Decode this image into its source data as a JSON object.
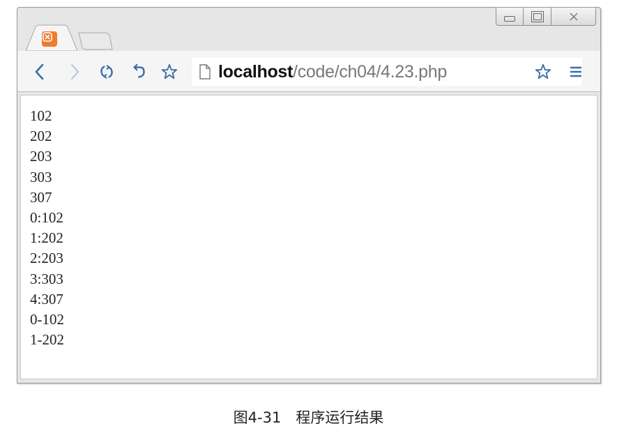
{
  "browser": {
    "address": {
      "host": "localhost",
      "path": "/code/ch04/4.23.php"
    },
    "icons": {
      "back": "back-arrow-icon",
      "forward": "forward-arrow-icon",
      "reload": "reload-icon",
      "undo": "undo-icon",
      "bookmark": "star-icon",
      "page": "page-icon",
      "menu": "menu-icon",
      "tab_favicon": "xampp-icon"
    },
    "colors": {
      "favicon": "#f07b2b",
      "toolbar_icon": "#3b6ea8"
    }
  },
  "page": {
    "lines": [
      "102",
      "202",
      "203",
      "303",
      "307",
      "0:102",
      "1:202",
      "2:203",
      "3:303",
      "4:307",
      "0-102",
      "1-202"
    ]
  },
  "caption": "图4-31　程序运行结果"
}
